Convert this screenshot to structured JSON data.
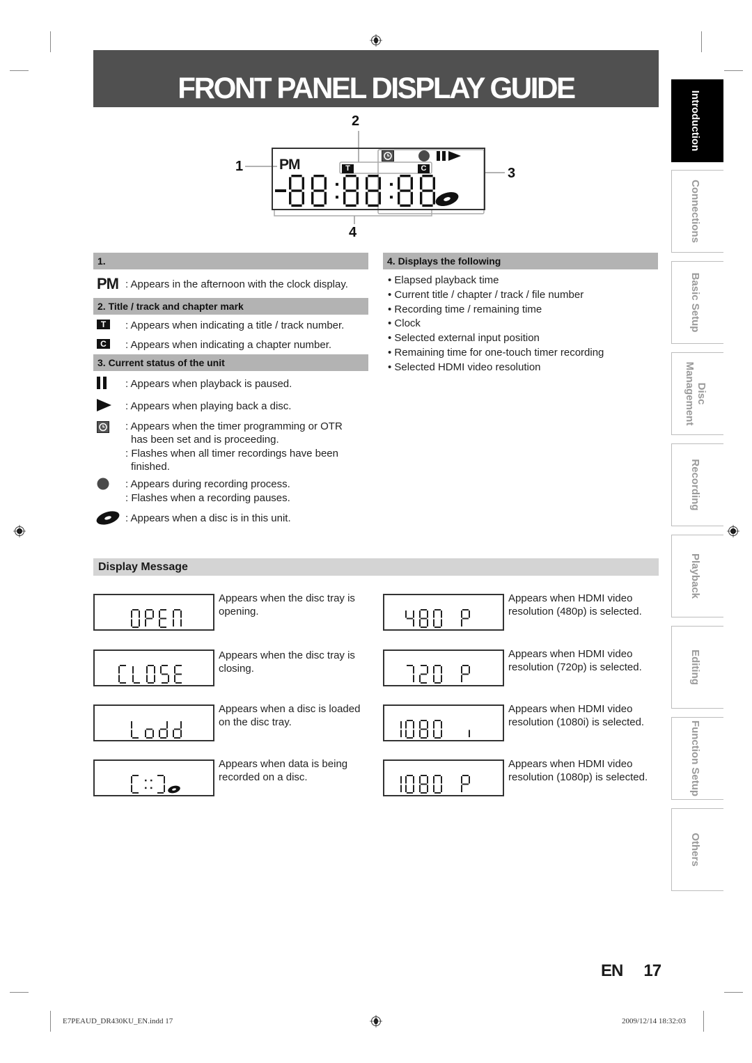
{
  "page": {
    "title": "FRONT PANEL DISPLAY GUIDE",
    "language": "EN",
    "page_number": "17"
  },
  "side_tabs": [
    {
      "label": "Introduction",
      "active": true
    },
    {
      "label": "Connections",
      "active": false
    },
    {
      "label": "Basic Setup",
      "active": false
    },
    {
      "label_lines": [
        "Disc",
        "Management"
      ],
      "label": "Disc Management",
      "active": false
    },
    {
      "label": "Recording",
      "active": false
    },
    {
      "label": "Playback",
      "active": false
    },
    {
      "label": "Editing",
      "active": false
    },
    {
      "label": "Function Setup",
      "active": false
    },
    {
      "label": "Others",
      "active": false
    }
  ],
  "diagram": {
    "callouts": [
      "1",
      "2",
      "3",
      "4"
    ],
    "pm_label": "PM",
    "title_mark": "T",
    "chapter_mark": "C",
    "segment_readout": "-88:88:88",
    "icons": [
      "timer-icon",
      "record-dot-icon",
      "pause-icon",
      "play-icon",
      "disc-icon"
    ]
  },
  "section1": {
    "heading": "1.",
    "items": [
      {
        "icon": "PM",
        "text": ": Appears in the afternoon with the clock display."
      }
    ]
  },
  "section2": {
    "heading": "2. Title / track and chapter mark",
    "items": [
      {
        "icon": "T",
        "text": ": Appears when indicating a title / track number."
      },
      {
        "icon": "C",
        "text": ": Appears when indicating a chapter number."
      }
    ]
  },
  "section3": {
    "heading": "3. Current status of the unit",
    "items": [
      {
        "icon": "pause",
        "lines": [
          ": Appears when playback is paused."
        ]
      },
      {
        "icon": "play",
        "lines": [
          ": Appears when playing back a disc."
        ]
      },
      {
        "icon": "timer",
        "lines": [
          ": Appears when the timer programming or OTR",
          "has been set and is proceeding.",
          ": Flashes when all timer recordings have been",
          "finished."
        ]
      },
      {
        "icon": "record",
        "lines": [
          ": Appears during recording process.",
          ": Flashes when a recording pauses."
        ]
      },
      {
        "icon": "disc",
        "lines": [
          ": Appears when a disc is in this unit."
        ]
      }
    ]
  },
  "section4": {
    "heading": "4. Displays the following",
    "items": [
      "• Elapsed playback time",
      "• Current title / chapter / track / file number",
      "• Recording time / remaining time",
      "• Clock",
      "• Selected external input position",
      "• Remaining time for one-touch timer recording",
      "• Selected HDMI video resolution"
    ]
  },
  "display_message": {
    "heading": "Display Message",
    "messages": [
      {
        "display": "OPEN",
        "lines": [
          "Appears when the disc tray is",
          "opening."
        ]
      },
      {
        "display": "CLOSE",
        "lines": [
          "Appears when the disc tray is",
          "closing."
        ]
      },
      {
        "display": "LoAd",
        "lines": [
          "Appears when a disc is loaded",
          "on the disc tray."
        ]
      },
      {
        "display": "[:::]",
        "lines": [
          "Appears when data is being",
          "recorded on a disc."
        ]
      },
      {
        "display": "480 P",
        "lines": [
          "Appears when HDMI video",
          "resolution (480p) is selected."
        ]
      },
      {
        "display": "720 P",
        "lines": [
          "Appears when HDMI video",
          "resolution (720p) is selected."
        ]
      },
      {
        "display": "1080 i",
        "lines": [
          "Appears when HDMI video",
          "resolution (1080i) is selected."
        ]
      },
      {
        "display": "1080 P",
        "lines": [
          "Appears when HDMI video",
          "resolution (1080p) is selected."
        ]
      }
    ]
  },
  "footer": {
    "file": "E7PEAUD_DR430KU_EN.indd   17",
    "timestamp": "2009/12/14   18:32:03"
  }
}
